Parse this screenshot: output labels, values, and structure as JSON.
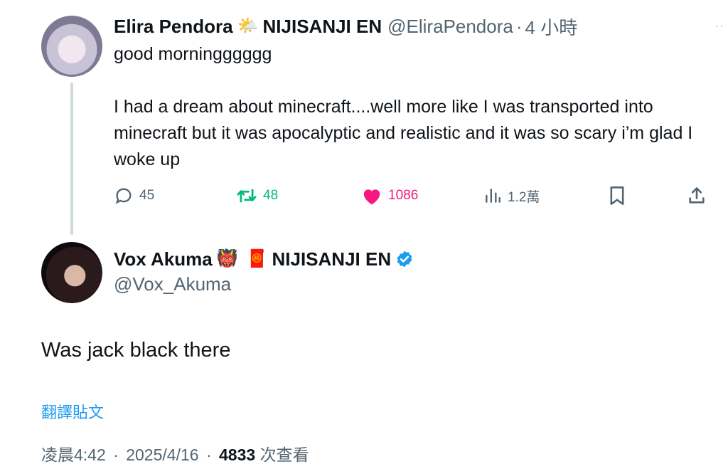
{
  "parent_tweet": {
    "display_name": "Elira Pendora",
    "emoji": "🌤️",
    "affiliation": "NIJISANJI EN",
    "handle": "@EliraPendora",
    "separator": "·",
    "time": "4 小時",
    "text": "good morningggggg\n\nI had a dream about minecraft....well more like I was transported into minecraft but it was apocalyptic and realistic and it was so scary i’m glad I woke up",
    "replies": "45",
    "retweets": "48",
    "likes": "1086",
    "views": "1.2萬"
  },
  "reply_tweet": {
    "display_name": "Vox Akuma",
    "emoji_1": "👹",
    "emoji_2": "🧧",
    "affiliation": "NIJISANJI EN",
    "handle": "@Vox_Akuma",
    "text": "Was jack black there",
    "translate_label": "翻譯貼文",
    "time": "凌晨4:42",
    "date": "2025/4/16",
    "separator": "·",
    "views_count": "4833",
    "views_label": "次查看"
  },
  "colors": {
    "text": "#0f1419",
    "secondary": "#536471",
    "retweet": "#00ba7c",
    "like": "#f91880",
    "link": "#1d9bf0",
    "thread_line": "#cfd9de"
  }
}
